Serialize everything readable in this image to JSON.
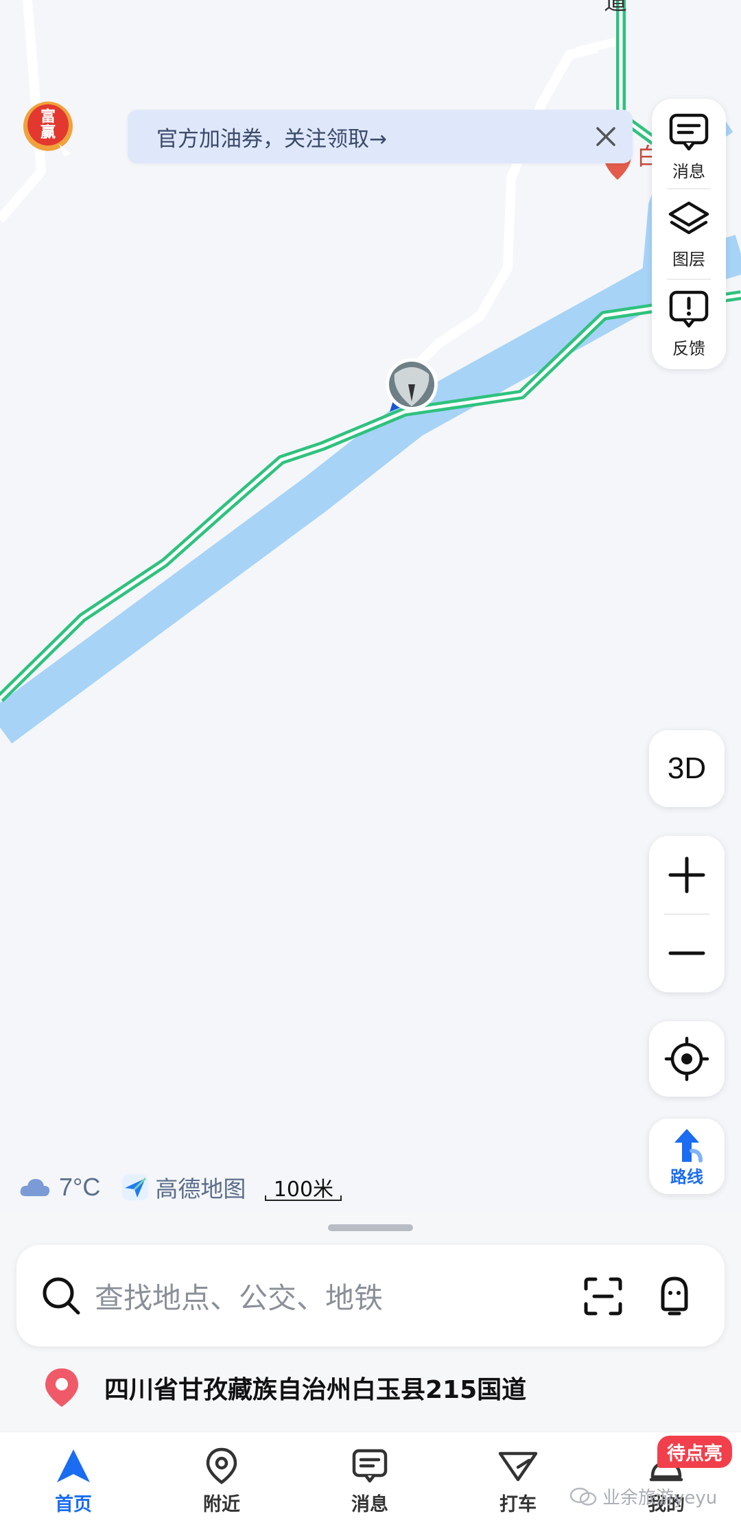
{
  "map": {
    "road_label_top": "道",
    "poi_label_right": "白"
  },
  "promo": {
    "badge_text": "富\n赢",
    "banner_text": "官方加油券，关注领取→"
  },
  "tools": [
    {
      "label": "消息",
      "icon": "message-icon"
    },
    {
      "label": "图层",
      "icon": "layers-icon"
    },
    {
      "label": "反馈",
      "icon": "feedback-icon"
    }
  ],
  "controls": {
    "mode_3d": "3D",
    "route_label": "路线"
  },
  "info": {
    "temperature": "7°C",
    "weather_icon": "cloud-icon",
    "brand": "高德地图",
    "scale": "100米"
  },
  "search": {
    "placeholder": "查找地点、公交、地铁"
  },
  "location": {
    "address": "四川省甘孜藏族自治州白玉县215国道"
  },
  "tabs": [
    {
      "label": "首页",
      "active": true
    },
    {
      "label": "附近",
      "active": false
    },
    {
      "label": "消息",
      "active": false
    },
    {
      "label": "打车",
      "active": false
    },
    {
      "label": "我的",
      "active": false
    }
  ],
  "mine_badge": "待点亮",
  "watermark": "业余旅游yeyu",
  "colors": {
    "accent": "#1a6cf0",
    "route": "#a7d3f7",
    "road": "#2ec27e",
    "badge": "#f1404b"
  }
}
